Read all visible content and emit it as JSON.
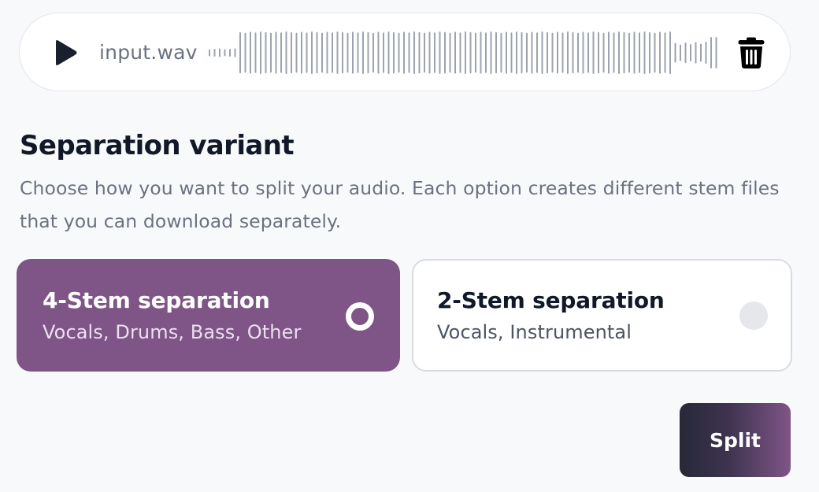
{
  "player": {
    "filename": "input.wav",
    "play_icon": "play-icon",
    "delete_icon": "trash-icon",
    "waveform_color": "#9ca3af"
  },
  "section": {
    "title": "Separation variant",
    "description": "Choose how you want to split your audio. Each option creates different stem files that you can download separately."
  },
  "options": [
    {
      "title": "4-Stem separation",
      "subtitle": "Vocals, Drums, Bass, Other",
      "selected": true
    },
    {
      "title": "2-Stem separation",
      "subtitle": "Vocals, Instrumental",
      "selected": false
    }
  ],
  "actions": {
    "split_label": "Split"
  },
  "colors": {
    "accent": "#7f5587",
    "accent_dark": "#272838",
    "background": "#f8f9fb",
    "card": "#ffffff"
  }
}
